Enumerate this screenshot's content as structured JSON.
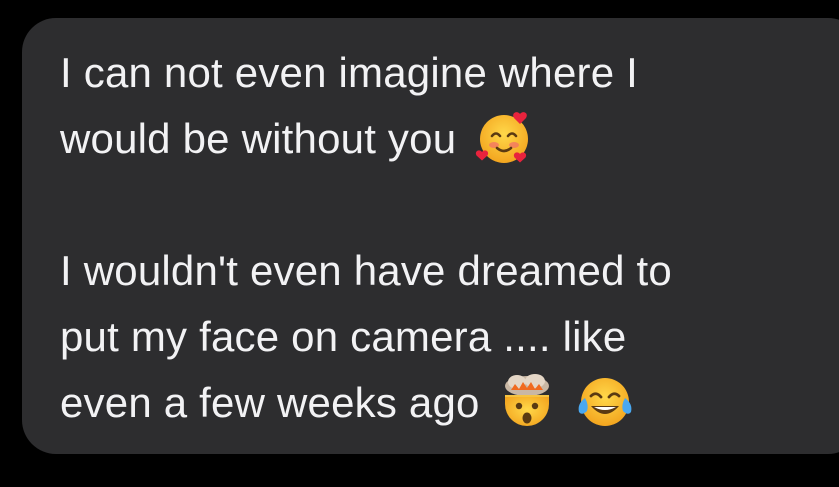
{
  "message": {
    "line1": "I can not even imagine where I",
    "line2": "would be without you",
    "line3": "I wouldn't even have dreamed to",
    "line4": "put my face on camera .... like",
    "line5": "even a few weeks ago",
    "emojis": [
      "smiling-face-with-hearts-icon",
      "exploding-head-icon",
      "face-with-tears-of-joy-icon"
    ]
  },
  "colors": {
    "background": "#000000",
    "bubble": "#2d2d2f",
    "text": "#f2f2f4"
  }
}
